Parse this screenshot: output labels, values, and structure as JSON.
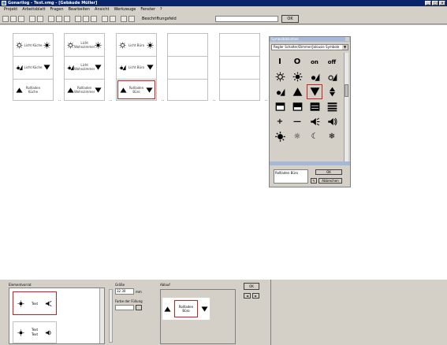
{
  "titlebar": {
    "title": "Gonarilog - Text.vmg - [Gebäude Müller]"
  },
  "menu": [
    "Projekt",
    "Arbeitsblatt",
    "Fragen",
    "Bearbeiten",
    "Ansicht",
    "Werkzeuge",
    "Fenster",
    "?"
  ],
  "toolbar": {
    "label": "Beschriftungsfeld",
    "ok_label": "OK"
  },
  "cards": [
    {
      "cells": [
        {
          "label": "Licht Küche",
          "left": "bulb",
          "right": "bulb-on",
          "selected": false
        },
        {
          "label": "Licht Küche",
          "left": "dimmer",
          "right": "triangle-down",
          "selected": false
        },
        {
          "label": "Rollladen Küche",
          "left": "triangle-up",
          "right": "",
          "selected": false
        }
      ]
    },
    {
      "cells": [
        {
          "label": "Licht Wohnzimmer",
          "left": "bulb",
          "right": "bulb-on",
          "selected": false
        },
        {
          "label": "Licht Wohnzimmer",
          "left": "dimmer",
          "right": "triangle-down",
          "selected": false
        },
        {
          "label": "Rollladen Wohnzimmer",
          "left": "triangle-up",
          "right": "triangle-down",
          "selected": false
        }
      ]
    },
    {
      "cells": [
        {
          "label": "Licht Büro",
          "left": "bulb",
          "right": "bulb-on",
          "selected": false
        },
        {
          "label": "Licht Büro",
          "left": "dimmer",
          "right": "triangle-down",
          "selected": false
        },
        {
          "label": "Rollladen Büro",
          "left": "triangle-up",
          "right": "triangle-down",
          "selected": true
        }
      ]
    },
    {
      "cells": [
        {
          "label": ""
        },
        {
          "label": ""
        },
        {
          "label": ""
        }
      ]
    },
    {
      "cells": [
        {
          "label": ""
        },
        {
          "label": ""
        },
        {
          "label": ""
        }
      ]
    }
  ],
  "palette": {
    "title": "Symbolbibliothek",
    "select": "Regler Schalter/Dimmer/Jalousie Symbole",
    "symbols": [
      {
        "name": "bar-icon",
        "text": "I"
      },
      {
        "name": "circle-icon",
        "text": "O"
      },
      {
        "name": "on-text",
        "text": "on"
      },
      {
        "name": "off-text",
        "text": "off"
      },
      {
        "name": "bulb-icon",
        "text": ""
      },
      {
        "name": "bulb-on-icon",
        "text": ""
      },
      {
        "name": "dimmer-up-icon",
        "text": ""
      },
      {
        "name": "dimmer-down-icon",
        "text": ""
      },
      {
        "name": "dimmer-icon",
        "text": ""
      },
      {
        "name": "triangle-up-icon",
        "text": ""
      },
      {
        "name": "triangle-down-icon",
        "text": "",
        "selected": true
      },
      {
        "name": "diamond-icon",
        "text": ""
      },
      {
        "name": "blind-open-icon",
        "text": ""
      },
      {
        "name": "blind-half-icon",
        "text": ""
      },
      {
        "name": "blind-closed-icon",
        "text": ""
      },
      {
        "name": "blind-lines-icon",
        "text": ""
      },
      {
        "name": "plus-icon",
        "text": "+"
      },
      {
        "name": "minus-icon",
        "text": "—"
      },
      {
        "name": "speaker-icon",
        "text": ""
      },
      {
        "name": "speaker-loud-icon",
        "text": ""
      },
      {
        "name": "bright-bulb-icon",
        "text": ""
      },
      {
        "name": "sun-icon",
        "text": "☼"
      },
      {
        "name": "moon-icon",
        "text": "☾"
      },
      {
        "name": "snowflake-icon",
        "text": "❄"
      }
    ],
    "footer_text": "Rollladen Büro",
    "ok_label": "OK",
    "abort_label": "Abbrechen"
  },
  "bottom": {
    "elements_label": "Elementvorrat",
    "element1_text": "Text",
    "element2_text_a": "Text",
    "element2_text_b": "Text",
    "size_label": "Größe",
    "size_value": "32 30",
    "size_unit": "mm",
    "fill_label": "Farbe der Füllung",
    "preview_label": "Ablauf",
    "preview_text": "Rollladen Büro",
    "ok_label": "OK"
  }
}
